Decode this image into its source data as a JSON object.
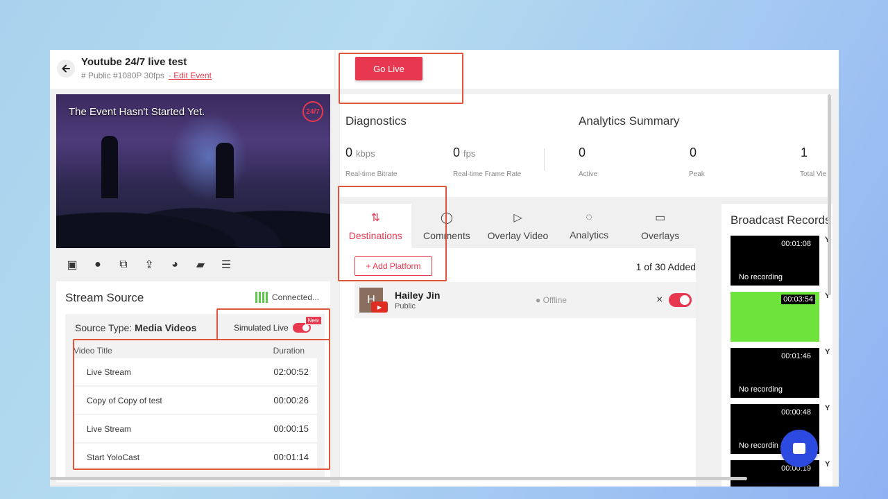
{
  "header": {
    "title": "Youtube 24/7 live test",
    "meta": "# Public #1080P 30fps",
    "edit_label": "· Edit Event",
    "go_live_label": "Go Live"
  },
  "preview": {
    "message": "The Event Hasn't Started Yet.",
    "badge": "24/7"
  },
  "toolbar": {
    "icons": [
      "image-icon",
      "play-icon",
      "embed-icon",
      "share-icon",
      "palette-icon",
      "camera-icon",
      "playlist-icon"
    ]
  },
  "stream_source": {
    "title": "Stream Source",
    "status": "Connected...",
    "source_type_label": "Source Type:",
    "source_type_value": "Media Videos",
    "simulated_live_label": "Simulated Live",
    "new_badge": "New",
    "columns": [
      "Video Title",
      "Duration"
    ],
    "videos": [
      {
        "title": "Live Stream",
        "duration": "02:00:52"
      },
      {
        "title": "Copy of Copy of test",
        "duration": "00:00:26"
      },
      {
        "title": "Live Stream",
        "duration": "00:00:15"
      },
      {
        "title": "Start YoloCast",
        "duration": "00:01:14"
      }
    ]
  },
  "diagnostics": {
    "title": "Diagnostics",
    "bitrate_value": "0",
    "bitrate_unit": "kbps",
    "bitrate_label": "Real-time Bitrate",
    "framerate_value": "0",
    "framerate_unit": "fps",
    "framerate_label": "Real-time Frame Rate"
  },
  "analytics": {
    "title": "Analytics Summary",
    "active_value": "0",
    "active_label": "Active",
    "peak_value": "0",
    "peak_label": "Peak",
    "total_value": "1",
    "total_label": "Total Vie"
  },
  "tabs": [
    {
      "label": "Destinations",
      "icon": "merge-icon"
    },
    {
      "label": "Comments",
      "icon": "chat-bubble-icon"
    },
    {
      "label": "Overlay Video",
      "icon": "video-icon"
    },
    {
      "label": "Analytics",
      "icon": "circle-chart-icon"
    },
    {
      "label": "Overlays",
      "icon": "overlay-icon"
    }
  ],
  "destinations": {
    "add_label": "+ Add Platform",
    "added_count": "1 of 30 Added",
    "platform": {
      "avatar_letter": "H",
      "name": "Hailey Jin",
      "visibility": "Public",
      "status": "● Offline",
      "remove": "×"
    }
  },
  "records": {
    "title": "Broadcast Records",
    "items": [
      {
        "time": "00:01:08",
        "label": "No recording",
        "side": "Y"
      },
      {
        "time": "00:03:54",
        "label": "",
        "side": "Y"
      },
      {
        "time": "00:01:46",
        "label": "No recording",
        "side": "Y"
      },
      {
        "time": "00:00:48",
        "label": "No recordin",
        "side": "Y"
      },
      {
        "time": "00:00:19",
        "label": "",
        "side": "Y"
      }
    ]
  },
  "colors": {
    "accent": "#e8384f",
    "connected": "#5fc74a",
    "chat": "#2d4ae0",
    "highlight": "#e0553a"
  }
}
